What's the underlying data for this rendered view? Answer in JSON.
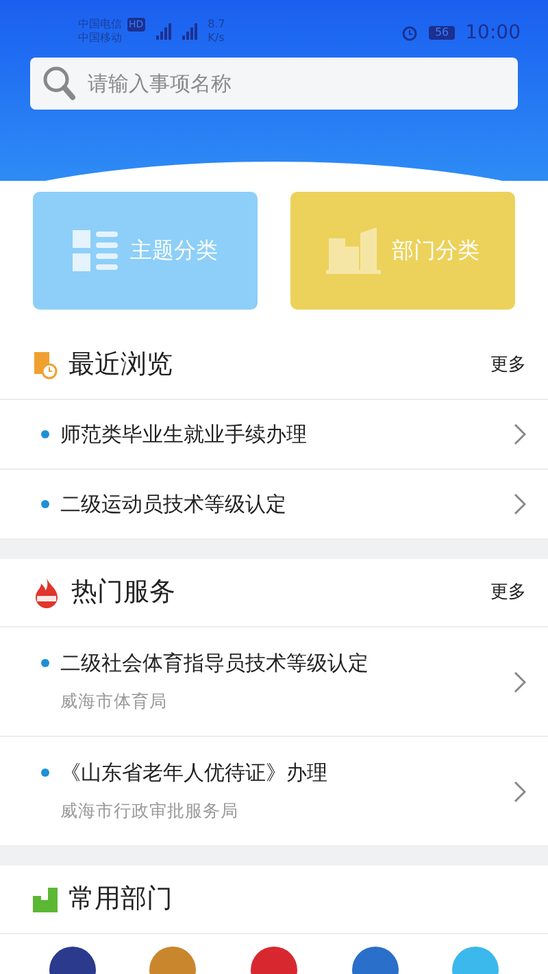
{
  "status_bar": {
    "carrier_1": "中国电信",
    "hd": "HD",
    "carrier_2": "中国移动",
    "speed": "8.7",
    "speed_unit": "K/s",
    "battery": "56",
    "time": "10:00"
  },
  "search": {
    "placeholder": "请输入事项名称"
  },
  "categories": [
    {
      "label": "主题分类",
      "kind": "theme"
    },
    {
      "label": "部门分类",
      "kind": "department"
    }
  ],
  "sections": [
    {
      "title": "最近浏览",
      "kind": "recent",
      "more": "更多",
      "items": [
        {
          "title": "师范类毕业生就业手续办理"
        },
        {
          "title": "二级运动员技术等级认定"
        }
      ]
    },
    {
      "title": "热门服务",
      "kind": "hot",
      "more": "更多",
      "items": [
        {
          "title": "二级社会体育指导员技术等级认定",
          "subtitle": "威海市体育局"
        },
        {
          "title": "《山东省老年人优待证》办理",
          "subtitle": "威海市行政审批服务局"
        }
      ]
    },
    {
      "title": "常用部门",
      "kind": "departments",
      "emblems": [
        {
          "color": "#2b3a8c"
        },
        {
          "color": "#c9862c"
        },
        {
          "color": "#d8282f"
        },
        {
          "color": "#2a6fc9"
        },
        {
          "color": "#3bb8ec"
        }
      ]
    }
  ]
}
